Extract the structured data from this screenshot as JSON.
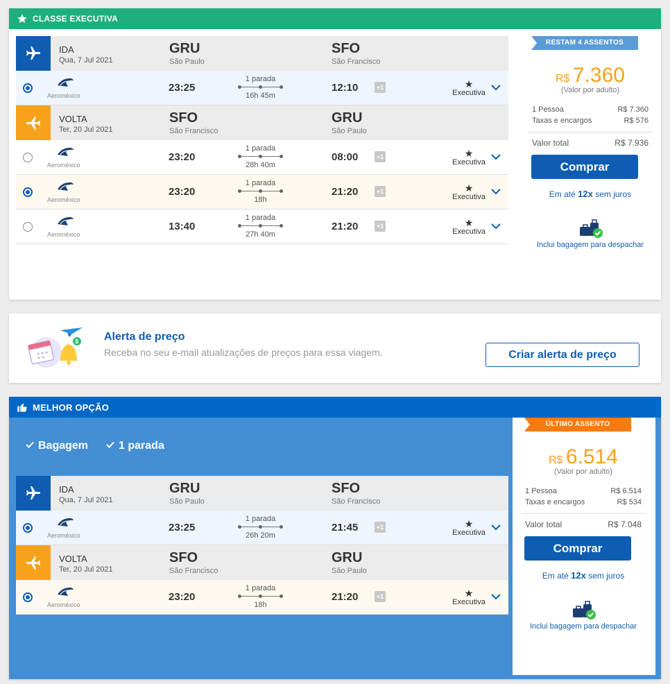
{
  "card1": {
    "banner": "CLASSE EXECUTIVA",
    "outbound": {
      "type": "IDA",
      "date": "Qua, 7 Jul 2021",
      "from_code": "GRU",
      "from_city": "São Paulo",
      "to_code": "SFO",
      "to_city": "São Francisco",
      "rows": [
        {
          "airline": "Aeroméxico",
          "dep": "23:25",
          "stops": "1 parada",
          "duration": "16h 45m",
          "arr": "12:10",
          "plus": "+1",
          "cabin": "Executiva",
          "selected": true
        }
      ]
    },
    "inbound": {
      "type": "VOLTA",
      "date": "Ter, 20 Jul 2021",
      "from_code": "SFO",
      "from_city": "São Francisco",
      "to_code": "GRU",
      "to_city": "São Paulo",
      "rows": [
        {
          "airline": "Aeroméxico",
          "dep": "23:20",
          "stops": "1 parada",
          "duration": "28h 40m",
          "arr": "08:00",
          "plus": "+1",
          "cabin": "Executiva",
          "selected": false
        },
        {
          "airline": "Aeroméxico",
          "dep": "23:20",
          "stops": "1 parada",
          "duration": "18h",
          "arr": "21:20",
          "plus": "+1",
          "cabin": "Executiva",
          "selected": true
        },
        {
          "airline": "Aeroméxico",
          "dep": "13:40",
          "stops": "1 parada",
          "duration": "27h 40m",
          "arr": "21:20",
          "plus": "+1",
          "cabin": "Executiva",
          "selected": false
        }
      ]
    },
    "price": {
      "ribbon": "RESTAM 4 ASSENTOS",
      "currency": "R$",
      "amount": "7.360",
      "note": "(Valor por adulto)",
      "pessoa_label": "1 Pessoa",
      "pessoa_value": "R$ 7.360",
      "taxas_label": "Taxas e encargos",
      "taxas_value": "R$ 576",
      "total_label": "Valor total",
      "total_value": "R$ 7.936",
      "buy": "Comprar",
      "installments_pre": "Em até",
      "installments_num": "12x",
      "installments_post": "sem juros",
      "baggage": "Inclui bagagem para despachar"
    }
  },
  "alert": {
    "title": "Alerta de preço",
    "subtitle": "Receba no seu e-mail atualizações de preços para essa viagem.",
    "button": "Criar alerta de preço"
  },
  "card3": {
    "banner": "MELHOR OPÇÃO",
    "tags": [
      "Bagagem",
      "1 parada"
    ],
    "outbound": {
      "type": "IDA",
      "date": "Qua, 7 Jul 2021",
      "from_code": "GRU",
      "from_city": "São Paulo",
      "to_code": "SFO",
      "to_city": "São Francisco",
      "rows": [
        {
          "airline": "Aeroméxico",
          "dep": "23:25",
          "stops": "1 parada",
          "duration": "26h 20m",
          "arr": "21:45",
          "plus": "+1",
          "cabin": "Executiva",
          "selected": true
        }
      ]
    },
    "inbound": {
      "type": "VOLTA",
      "date": "Ter, 20 Jul 2021",
      "from_code": "SFO",
      "from_city": "São Francisco",
      "to_code": "GRU",
      "to_city": "São Paulo",
      "rows": [
        {
          "airline": "Aeroméxico",
          "dep": "23:20",
          "stops": "1 parada",
          "duration": "18h",
          "arr": "21:20",
          "plus": "+1",
          "cabin": "Executiva",
          "selected": true
        }
      ]
    },
    "price": {
      "ribbon": "ÚLTIMO ASSENTO",
      "currency": "R$",
      "amount": "6.514",
      "note": "(Valor por adulto)",
      "pessoa_label": "1 Pessoa",
      "pessoa_value": "R$ 6.514",
      "taxas_label": "Taxas e encargos",
      "taxas_value": "R$ 534",
      "total_label": "Valor total",
      "total_value": "R$ 7.048",
      "buy": "Comprar",
      "installments_pre": "Em até",
      "installments_num": "12x",
      "installments_post": "sem juros",
      "baggage": "Inclui bagagem para despachar"
    }
  },
  "colors": {
    "green_banner": "#1fae7e",
    "blue_banner": "#0067c5",
    "best_bg": "#448fd4",
    "brand_blue": "#0e5db3",
    "volta_orange": "#f7a21b",
    "price_orange": "#f7a21b",
    "ribbon_blue": "#5b9bd8",
    "ribbon_orange": "#f87b12"
  },
  "icons": [
    "star-icon",
    "thumbs-up-icon",
    "plane-depart-icon",
    "plane-return-icon",
    "airline-logo-icon",
    "calendar-plus-icon",
    "chevron-down-icon",
    "baggage-check-icon",
    "price-alert-illustration",
    "check-icon"
  ]
}
